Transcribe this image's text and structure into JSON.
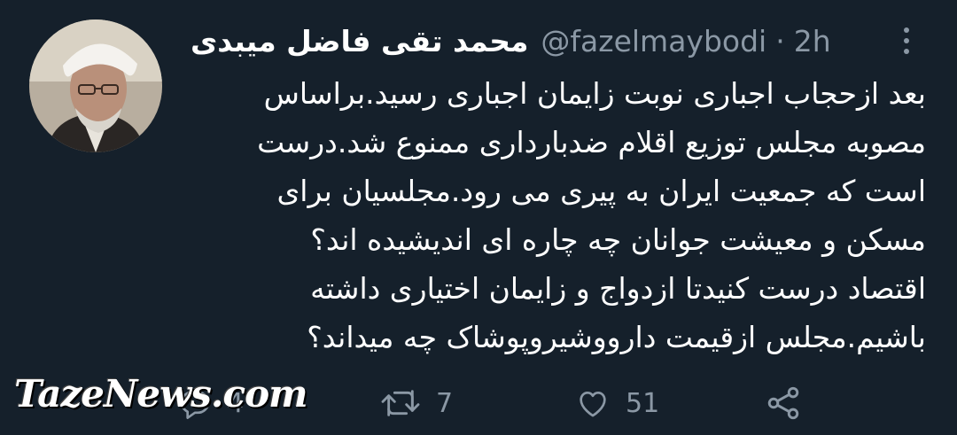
{
  "tweet": {
    "author_name": "محمد تقی فاضل میبدی",
    "handle": "@fazelmaybodi",
    "separator": "·",
    "time": "2h",
    "more_icon": "more-vertical-icon",
    "body_lines": [
      "بعد ازحجاب اجباری نوبت زایمان اجباری رسید.براساس",
      "مصوبه مجلس توزیع اقلام ضدبارداری ممنوع شد.درست",
      "است که جمعیت ایران به پیری می رود.مجلسیان برای",
      "مسکن و معیشت جوانان چه چاره ای اندیشیده اند؟",
      "اقتصاد درست کنیدتا ازدواج و زایمان اختیاری داشته",
      "باشیم.مجلس ازقیمت دارووشیروپوشاک چه میداند؟"
    ]
  },
  "actions": {
    "reply": {
      "icon": "reply-icon",
      "count": "4"
    },
    "retweet": {
      "icon": "retweet-icon",
      "count": "7"
    },
    "like": {
      "icon": "heart-icon",
      "count": "51"
    },
    "share": {
      "icon": "share-icon"
    }
  },
  "watermark": "TazeNews.com",
  "colors": {
    "background": "#15202b",
    "text": "#ffffff",
    "muted": "#8b98a5"
  }
}
